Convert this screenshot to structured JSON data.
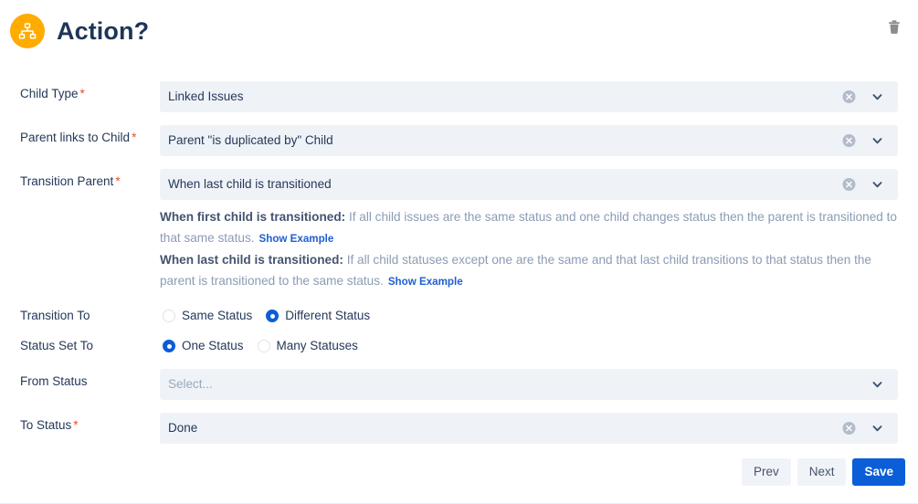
{
  "header": {
    "title": "Action?",
    "icon": "hierarchy-icon",
    "icon_bg": "#ffab00",
    "delete_icon": "trash-icon"
  },
  "colors": {
    "accent": "#0b5ed7",
    "title_text": "#1d3557",
    "label_text": "#253858",
    "field_bg": "#eff3f8",
    "help_text": "#8b9bb4",
    "required_asterisk": "#e8502a",
    "link": "#1d5fd1"
  },
  "fields": {
    "child_type": {
      "label": "Child Type",
      "required": "*",
      "value": "Linked Issues",
      "has_clear": true,
      "clear_icon": "clear-circle-icon",
      "chevron_icon": "chevron-down-icon"
    },
    "parent_links_to_child": {
      "label": "Parent links to Child",
      "required": "*",
      "value": "Parent \"is duplicated by\" Child",
      "has_clear": true,
      "clear_icon": "clear-circle-icon",
      "chevron_icon": "chevron-down-icon"
    },
    "transition_parent": {
      "label": "Transition Parent",
      "required": "*",
      "value": "When last child is transitioned",
      "has_clear": true,
      "clear_icon": "clear-circle-icon",
      "chevron_icon": "chevron-down-icon"
    },
    "from_status": {
      "label": "From Status",
      "required": "",
      "value": "Select...",
      "is_placeholder": true,
      "has_clear": false,
      "chevron_icon": "chevron-down-icon"
    },
    "to_status": {
      "label": "To Status",
      "required": "*",
      "value": "Done",
      "has_clear": true,
      "clear_icon": "clear-circle-icon",
      "chevron_icon": "chevron-down-icon"
    }
  },
  "help": {
    "first": {
      "bold": "When first child is transitioned:",
      "text": "If all child issues are the same status and one child changes status then the parent is transitioned to that same status.",
      "link": "Show Example"
    },
    "last": {
      "bold": "When last child is transitioned:",
      "text": "If all child statuses except one are the same and that last child transitions to that status then the parent is transitioned to the same status.",
      "link": "Show Example"
    }
  },
  "radios": {
    "transition_to": {
      "label": "Transition To",
      "options": [
        {
          "label": "Same Status",
          "selected": false
        },
        {
          "label": "Different Status",
          "selected": true
        }
      ]
    },
    "status_set_to": {
      "label": "Status Set To",
      "options": [
        {
          "label": "One Status",
          "selected": true
        },
        {
          "label": "Many Statuses",
          "selected": false
        }
      ]
    }
  },
  "footer": {
    "prev_label": "Prev",
    "next_label": "Next",
    "save_label": "Save"
  }
}
